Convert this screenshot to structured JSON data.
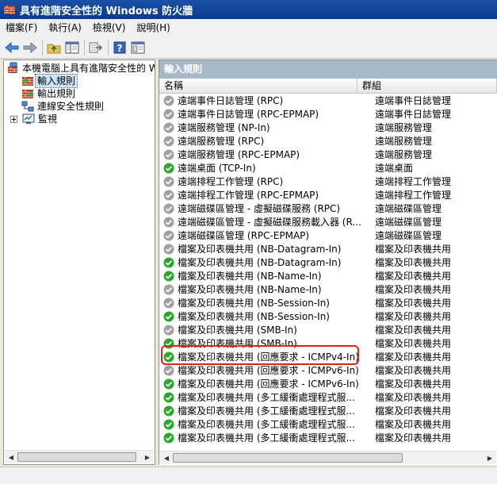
{
  "window": {
    "title": "具有進階安全性的 Windows 防火牆"
  },
  "menu": [
    "檔案(F)",
    "執行(A)",
    "檢視(V)",
    "說明(H)"
  ],
  "toolbar": {
    "icons": [
      "back-arrow-icon",
      "forward-arrow-icon",
      "up-folder-icon",
      "show-hide-tree-icon",
      "export-list-icon",
      "help-icon",
      "properties-icon"
    ]
  },
  "tree": {
    "root": "本機電腦上具有進階安全性的 W",
    "items": [
      "輸入規則",
      "輸出規則",
      "連線安全性規則",
      "監視"
    ]
  },
  "pane": {
    "title": "輸入規則",
    "columns": [
      "名稱",
      "群組"
    ]
  },
  "colors": {
    "enabled": "#2aa82a",
    "disabled": "#a0a0a0",
    "highlight": "#e02020",
    "pane_title": "#a9b8c7"
  },
  "rules": [
    {
      "name": "遠端事件日誌管理 (RPC)",
      "group": "遠端事件日誌管理",
      "enabled": false
    },
    {
      "name": "遠端事件日誌管理 (RPC-EPMAP)",
      "group": "遠端事件日誌管理",
      "enabled": false
    },
    {
      "name": "遠端服務管理 (NP-In)",
      "group": "遠端服務管理",
      "enabled": false
    },
    {
      "name": "遠端服務管理 (RPC)",
      "group": "遠端服務管理",
      "enabled": false
    },
    {
      "name": "遠端服務管理 (RPC-EPMAP)",
      "group": "遠端服務管理",
      "enabled": false
    },
    {
      "name": "遠端桌面 (TCP-In)",
      "group": "遠端桌面",
      "enabled": true
    },
    {
      "name": "遠端排程工作管理 (RPC)",
      "group": "遠端排程工作管理",
      "enabled": false
    },
    {
      "name": "遠端排程工作管理 (RPC-EPMAP)",
      "group": "遠端排程工作管理",
      "enabled": false
    },
    {
      "name": "遠端磁碟區管理 - 虛擬磁碟服務 (RPC)",
      "group": "遠端磁碟區管理",
      "enabled": false
    },
    {
      "name": "遠端磁碟區管理 - 虛擬磁碟服務載入器 (R...",
      "group": "遠端磁碟區管理",
      "enabled": false
    },
    {
      "name": "遠端磁碟區管理 (RPC-EPMAP)",
      "group": "遠端磁碟區管理",
      "enabled": false
    },
    {
      "name": "檔案及印表機共用 (NB-Datagram-In)",
      "group": "檔案及印表機共用",
      "enabled": false
    },
    {
      "name": "檔案及印表機共用 (NB-Datagram-In)",
      "group": "檔案及印表機共用",
      "enabled": true
    },
    {
      "name": "檔案及印表機共用 (NB-Name-In)",
      "group": "檔案及印表機共用",
      "enabled": true
    },
    {
      "name": "檔案及印表機共用 (NB-Name-In)",
      "group": "檔案及印表機共用",
      "enabled": false
    },
    {
      "name": "檔案及印表機共用 (NB-Session-In)",
      "group": "檔案及印表機共用",
      "enabled": false
    },
    {
      "name": "檔案及印表機共用 (NB-Session-In)",
      "group": "檔案及印表機共用",
      "enabled": true
    },
    {
      "name": "檔案及印表機共用 (SMB-In)",
      "group": "檔案及印表機共用",
      "enabled": false
    },
    {
      "name": "檔案及印表機共用 (SMB-In)",
      "group": "檔案及印表機共用",
      "enabled": true
    },
    {
      "name": "檔案及印表機共用 (回應要求 - ICMPv4-In)",
      "group": "檔案及印表機共用",
      "enabled": true
    },
    {
      "name": "檔案及印表機共用 (回應要求 - ICMPv6-In)",
      "group": "檔案及印表機共用",
      "enabled": false
    },
    {
      "name": "檔案及印表機共用 (回應要求 - ICMPv6-In)",
      "group": "檔案及印表機共用",
      "enabled": true
    },
    {
      "name": "檔案及印表機共用 (多工緩衝處理程式服...",
      "group": "檔案及印表機共用",
      "enabled": true
    },
    {
      "name": "檔案及印表機共用 (多工緩衝處理程式服...",
      "group": "檔案及印表機共用",
      "enabled": true
    },
    {
      "name": "檔案及印表機共用 (多工緩衝處理程式服...",
      "group": "檔案及印表機共用",
      "enabled": true
    },
    {
      "name": "檔案及印表機共用 (多工緩衝處理程式服...",
      "group": "檔案及印表機共用",
      "enabled": true
    }
  ]
}
